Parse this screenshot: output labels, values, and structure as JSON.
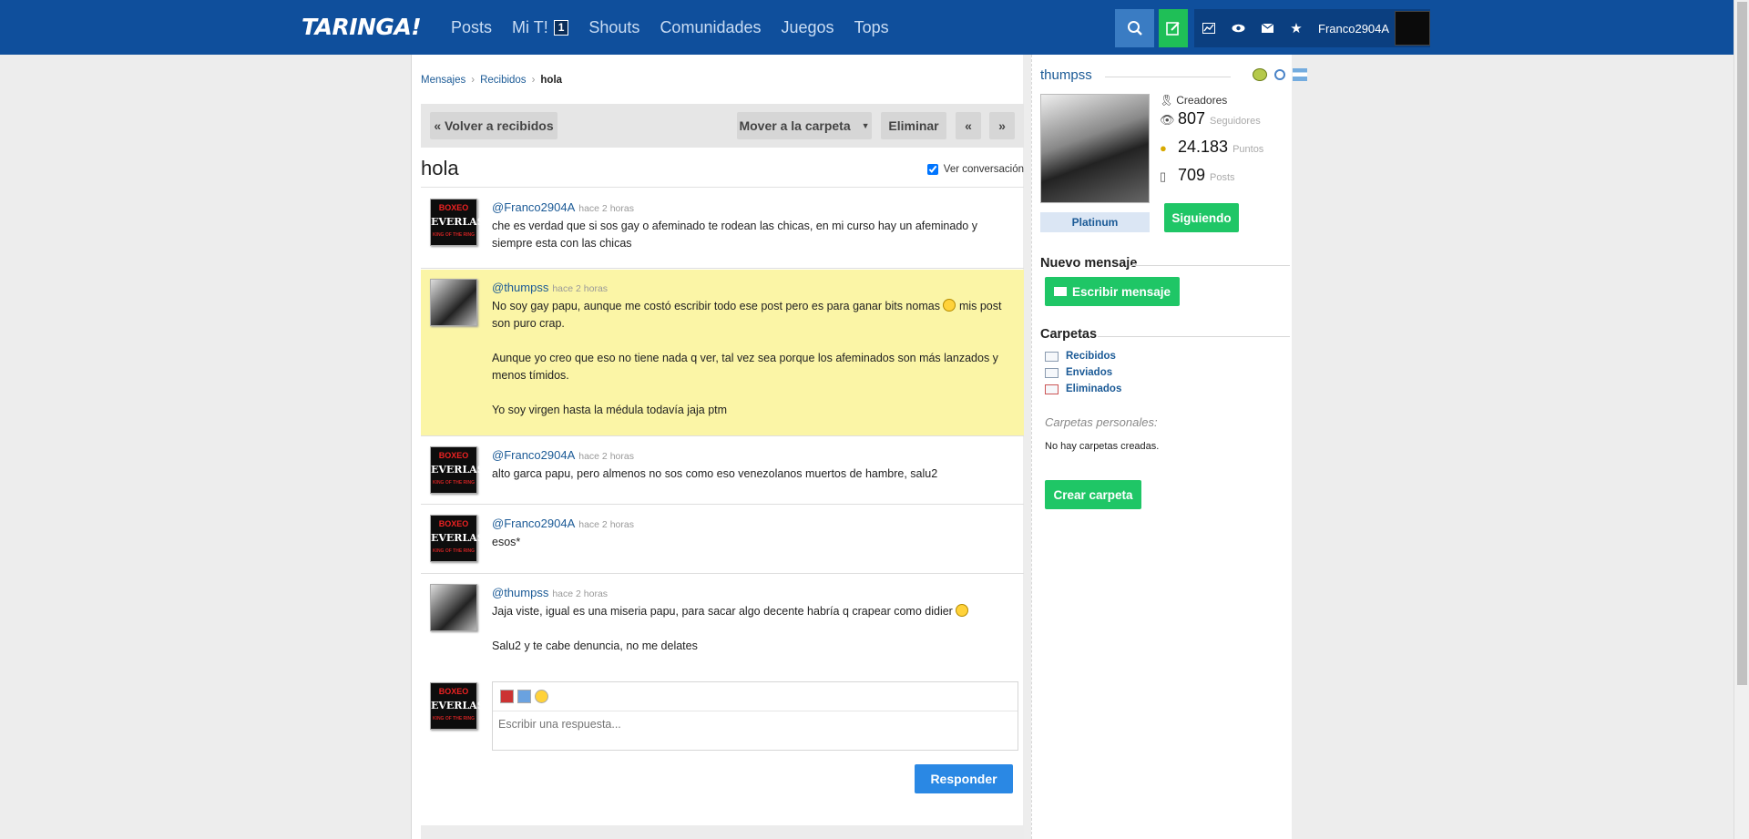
{
  "colors": {
    "nav_bg": "#0f4f9c",
    "accent_green": "#1fc666",
    "accent_blue": "#2a88e4",
    "highlight": "#fbf5a6"
  },
  "header": {
    "logo": "TARINGA!",
    "nav": [
      {
        "label": "Posts"
      },
      {
        "label": "Mi T!",
        "badge": "1"
      },
      {
        "label": "Shouts"
      },
      {
        "label": "Comunidades"
      },
      {
        "label": "Juegos"
      },
      {
        "label": "Tops"
      }
    ],
    "icons": [
      "search-icon",
      "new-post-icon",
      "stats-icon",
      "eye-icon",
      "mail-icon",
      "star-icon"
    ],
    "username": "Franco2904A"
  },
  "breadcrumb": [
    "Mensajes",
    "Recibidos",
    "hola"
  ],
  "toolbar": {
    "back": "« Volver a recibidos",
    "move": "Mover a la carpeta",
    "move_arrow": "▼",
    "delete": "Eliminar",
    "prev": "«",
    "next": "»"
  },
  "conversation": {
    "title": "hola",
    "view_label": "Ver conversación"
  },
  "messages": [
    {
      "user": "@Franco2904A",
      "when": "hace 2 horas",
      "lines": [
        "che es verdad que si sos gay o afeminado te rodean las chicas, en mi curso hay un afeminado y siempre esta con las chicas"
      ]
    },
    {
      "user": "@thumpss",
      "when": "hace 2 horas",
      "lines": [
        "No soy gay papu, aunque me costó escribir todo ese post pero es para ganar bits nomas",
        "mis post son puro crap.",
        "Aunque yo creo que eso no tiene nada q ver, tal vez sea porque los afeminados son más lanzados y menos tímidos.",
        "Yo soy virgen hasta la médula todavía jaja ptm"
      ]
    },
    {
      "user": "@Franco2904A",
      "when": "hace 2 horas",
      "lines": [
        "alto garca papu, pero almenos no sos como eso venezolanos muertos de hambre, salu2"
      ]
    },
    {
      "user": "@Franco2904A",
      "when": "hace 2 horas",
      "lines": [
        "esos*"
      ]
    },
    {
      "user": "@thumpss",
      "when": "hace 2 horas",
      "lines": [
        "Jaja viste, igual es una miseria papu, para sacar algo decente habría q crapear como didier",
        "Salu2 y te cabe denuncia, no me delates"
      ]
    }
  ],
  "avatar_text": {
    "top": "BOXEO",
    "middle": "EVERLAST",
    "bottom": "KING OF THE RING"
  },
  "reply": {
    "placeholder": "Escribir una respuesta...",
    "submit": "Responder"
  },
  "sidebar": {
    "name": "thumpss",
    "rank": "Creadores",
    "stats": [
      {
        "value": "807",
        "label": "Seguidores"
      },
      {
        "value": "24.183",
        "label": "Puntos"
      },
      {
        "value": "709",
        "label": "Posts"
      }
    ],
    "level": "Platinum",
    "follow": "Siguiendo",
    "new_message_title": "Nuevo mensaje",
    "write_button": "Escribir mensaje",
    "folders_title": "Carpetas",
    "folders": [
      "Recibidos",
      "Enviados",
      "Eliminados"
    ],
    "personal_title": "Carpetas personales:",
    "no_folders": "No hay carpetas creadas.",
    "create_folder": "Crear carpeta"
  }
}
